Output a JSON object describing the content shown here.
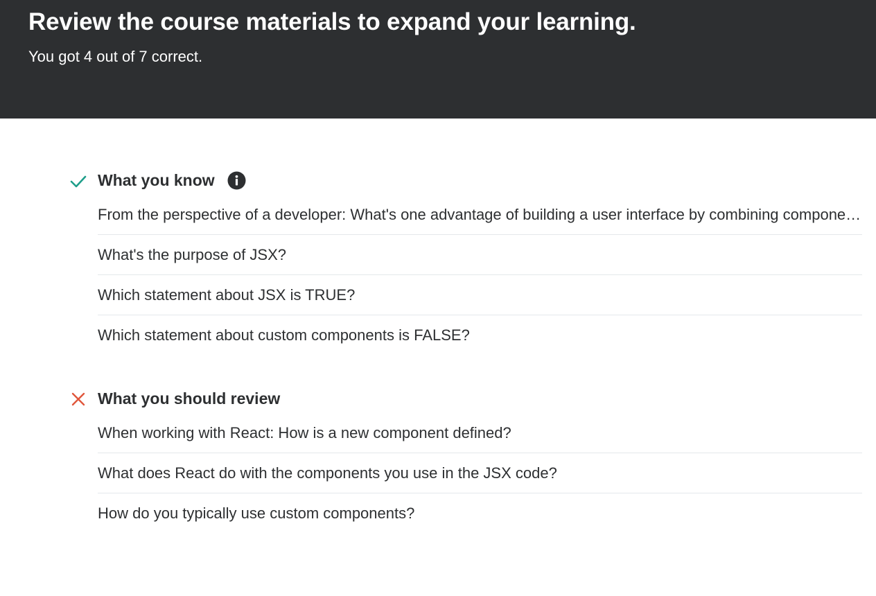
{
  "header": {
    "title": "Review the course materials to expand your learning.",
    "score_text": "You got 4 out of 7 correct."
  },
  "sections": {
    "know": {
      "title": "What you know",
      "status_icon": "check-icon",
      "status_color": "#1e9e8a",
      "info_icon": "info-icon",
      "items": [
        "From the perspective of a developer: What's one advantage of building a user interface by combining components?",
        "What's the purpose of JSX?",
        "Which statement about JSX is TRUE?",
        "Which statement about custom components is FALSE?"
      ]
    },
    "review": {
      "title": "What you should review",
      "status_icon": "close-icon",
      "status_color": "#e0563b",
      "items": [
        "When working with React: How is a new component defined?",
        "What does React do with the components you use in the JSX code?",
        "How do you typically use custom components?"
      ]
    }
  },
  "colors": {
    "header_bg": "#2d2f31",
    "text": "#2d2f31",
    "divider": "#e4e8eb"
  }
}
